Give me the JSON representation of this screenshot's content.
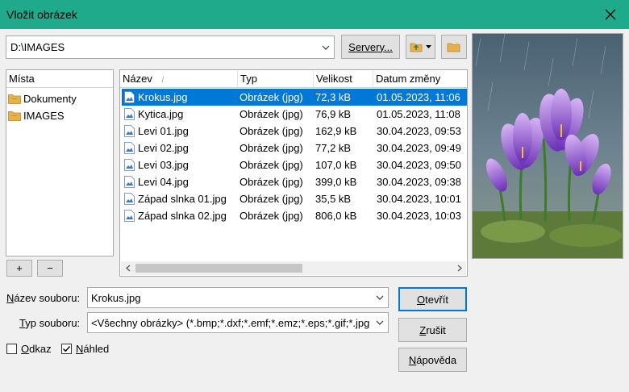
{
  "window": {
    "title": "Vložit obrázek"
  },
  "toolbar": {
    "path_value": "D:\\IMAGES",
    "servers_label": "Servery..."
  },
  "places": {
    "header": "Místa",
    "items": [
      {
        "label": "Dokumenty"
      },
      {
        "label": "IMAGES"
      }
    ],
    "add_label": "+",
    "remove_label": "−"
  },
  "files": {
    "columns": {
      "name": "Název",
      "type": "Typ",
      "size": "Velikost",
      "date": "Datum změny"
    },
    "sort_indicator": "/",
    "rows": [
      {
        "name": "Krokus.jpg",
        "type": "Obrázek (jpg)",
        "size": "72,3 kB",
        "date": "01.05.2023, 11:06"
      },
      {
        "name": "Kytica.jpg",
        "type": "Obrázek (jpg)",
        "size": "76,9 kB",
        "date": "01.05.2023, 11:08"
      },
      {
        "name": "Levi 01.jpg",
        "type": "Obrázek (jpg)",
        "size": "162,9 kB",
        "date": "30.04.2023, 09:53"
      },
      {
        "name": "Levi 02.jpg",
        "type": "Obrázek (jpg)",
        "size": "77,2 kB",
        "date": "30.04.2023, 09:49"
      },
      {
        "name": "Levi 03.jpg",
        "type": "Obrázek (jpg)",
        "size": "107,0 kB",
        "date": "30.04.2023, 09:50"
      },
      {
        "name": "Levi 04.jpg",
        "type": "Obrázek (jpg)",
        "size": "399,0 kB",
        "date": "30.04.2023, 09:38"
      },
      {
        "name": "Západ slnka 01.jpg",
        "type": "Obrázek (jpg)",
        "size": "35,5 kB",
        "date": "30.04.2023, 10:01"
      },
      {
        "name": "Západ slnka 02.jpg",
        "type": "Obrázek (jpg)",
        "size": "806,0 kB",
        "date": "30.04.2023, 10:03"
      }
    ],
    "selected_index": 0
  },
  "form": {
    "filename_label_u": "N",
    "filename_label_rest": "ázev souboru:",
    "filename_value": "Krokus.jpg",
    "filetype_label_u": "T",
    "filetype_label_rest": "yp souboru:",
    "filetype_value": "<Všechny obrázky> (*.bmp;*.dxf;*.emf;*.emz;*.eps;*.gif;*.jpg",
    "link_label_u": "O",
    "link_label_rest": "dkaz",
    "link_checked": false,
    "preview_label_u": "N",
    "preview_label_rest": "áhled",
    "preview_checked": true
  },
  "buttons": {
    "open_u": "O",
    "open_rest": "tevřít",
    "cancel_u": "Z",
    "cancel_rest": "rušit",
    "help_u": "N",
    "help_rest": "ápověda"
  },
  "colors": {
    "titlebar": "#1faa8c",
    "selection": "#0078d7",
    "folder": "#e8b04a"
  }
}
